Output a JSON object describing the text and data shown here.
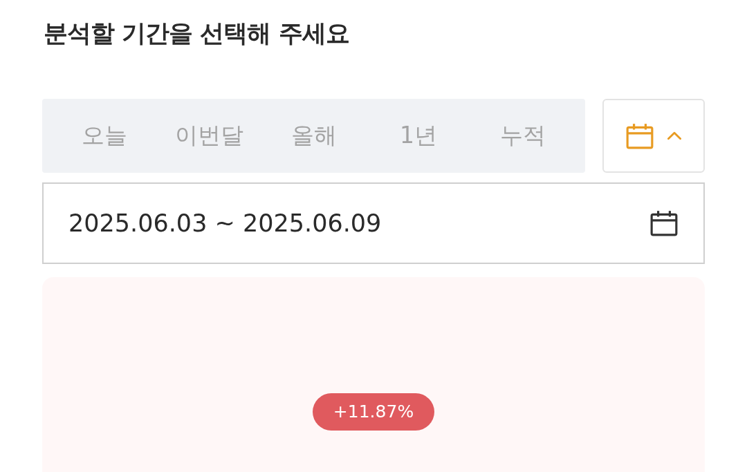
{
  "title": "분석할 기간을 선택해 주세요",
  "period_tabs": [
    {
      "label": "오늘",
      "selected": false
    },
    {
      "label": "이번달",
      "selected": false
    },
    {
      "label": "올해",
      "selected": false
    },
    {
      "label": "1년",
      "selected": false
    },
    {
      "label": "누적",
      "selected": false
    }
  ],
  "calendar_toggle": {
    "expanded": true
  },
  "date_range": {
    "value": "2025.06.03 ~ 2025.06.09"
  },
  "summary": {
    "change": "+11.87%"
  }
}
